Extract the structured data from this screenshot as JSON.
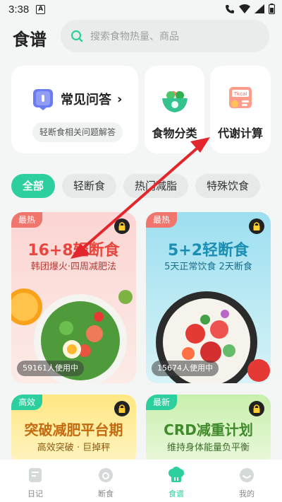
{
  "status_bar": {
    "time": "3:38",
    "indicator": "A"
  },
  "header": {
    "title": "食谱",
    "search_placeholder": "搜索食物热量、商品"
  },
  "quick": {
    "faq": {
      "label": "常见问答",
      "chevron": "›",
      "sub": "轻断食相关问题解答"
    },
    "food_category": {
      "label": "食物分类"
    },
    "metabolism": {
      "label": "代谢计算",
      "kcal": "Tkcal"
    }
  },
  "tabs": [
    {
      "label": "全部",
      "active": true
    },
    {
      "label": "轻断食"
    },
    {
      "label": "热门减脂"
    },
    {
      "label": "特殊饮食"
    }
  ],
  "plans": [
    {
      "badge": "最热",
      "title": "16+8轻断食",
      "subtitle": "韩团爆火·四周减肥法",
      "users": "59161人使用中",
      "title_color": "#e8473f",
      "badge_color": "#f0756d"
    },
    {
      "badge": "最热",
      "title": "5+2轻断食",
      "subtitle": "5天正常饮食 2天断食",
      "users": "15674人使用中",
      "title_color": "#1a8fb3",
      "badge_color": "#f0756d"
    },
    {
      "badge": "高效",
      "title": "突破减肥平台期",
      "subtitle": "高效突破 · 巨掉秤",
      "title_color": "#c46a10",
      "badge_color": "#2ccf9d"
    },
    {
      "badge": "最新",
      "title": "CRD减重计划",
      "subtitle": "维持身体能量负平衡",
      "title_color": "#3f8a2a",
      "badge_color": "#2ccf9d"
    }
  ],
  "bottom_nav": [
    {
      "label": "日记"
    },
    {
      "label": "断食"
    },
    {
      "label": "食谱",
      "active": true
    },
    {
      "label": "我的"
    }
  ],
  "colors": {
    "accent": "#2ccf9d",
    "annotation_arrow": "#e3262b"
  }
}
